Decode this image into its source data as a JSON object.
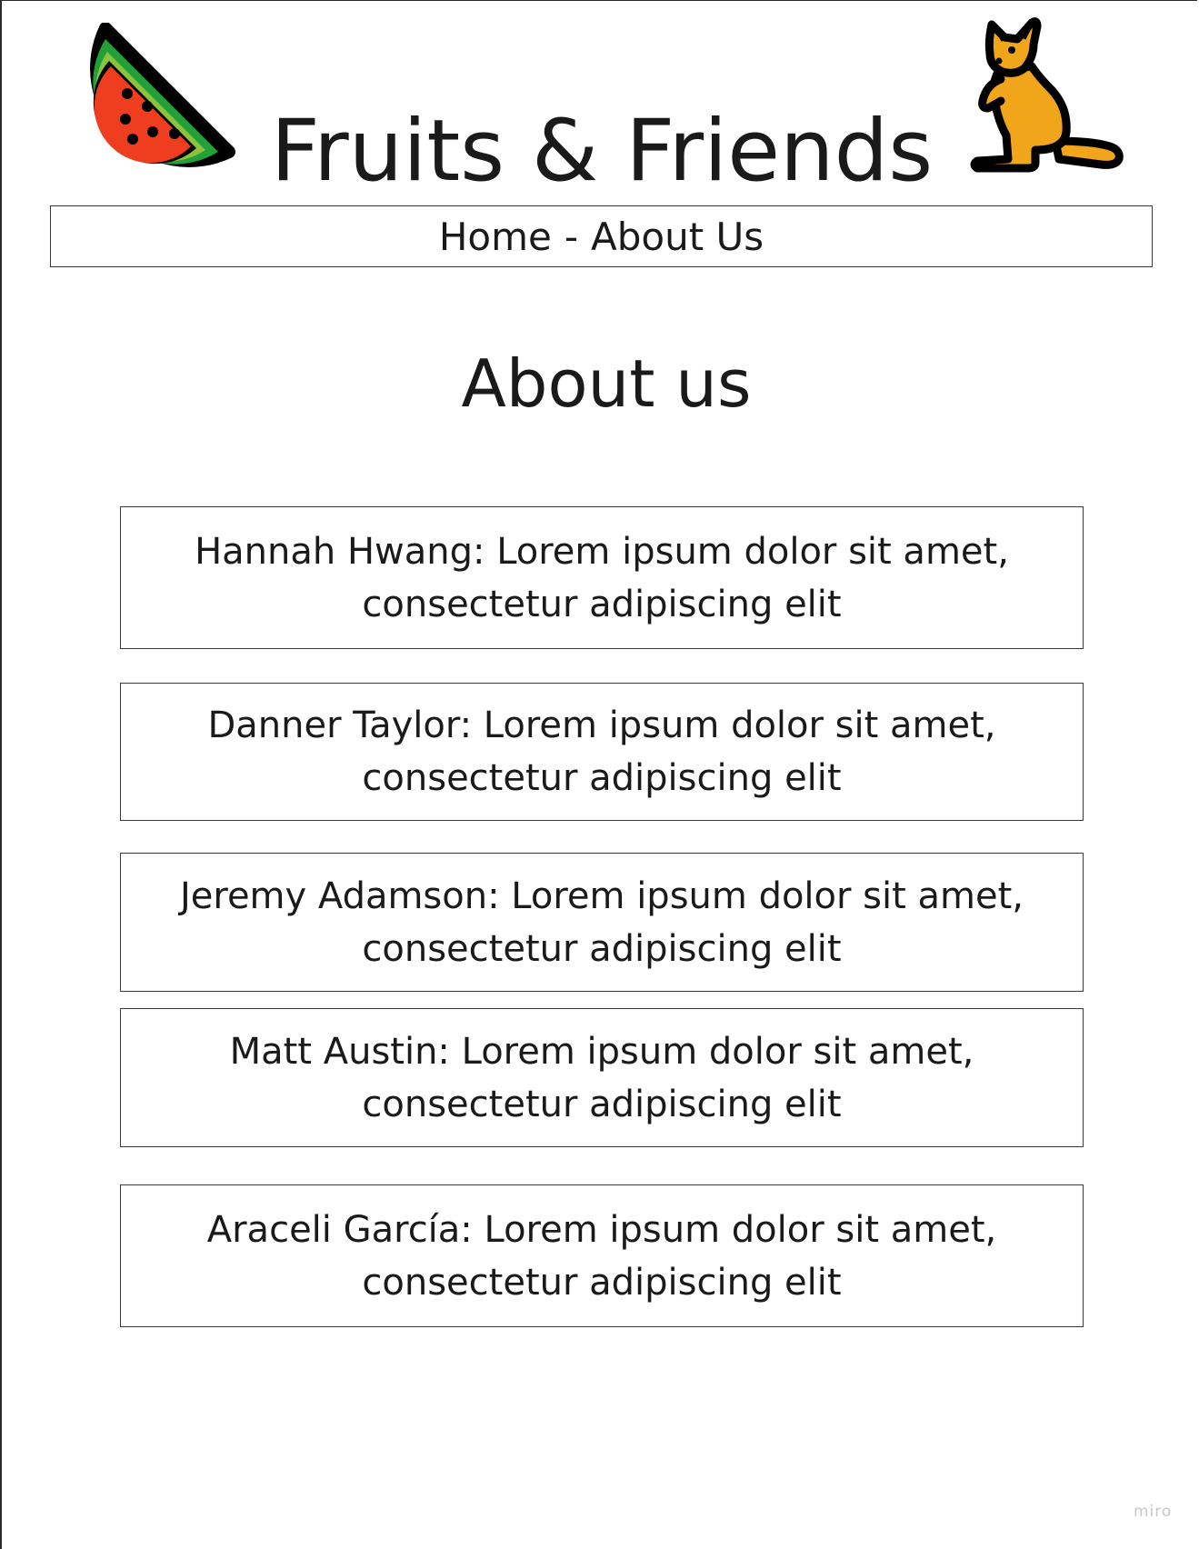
{
  "header": {
    "title": "Fruits & Friends",
    "left_logo_icon": "watermelon-icon",
    "right_logo_icon": "kangaroo-icon"
  },
  "nav": {
    "home_label": "Home",
    "separator": "-",
    "about_label": "About Us"
  },
  "main": {
    "heading": "About us",
    "members": [
      {
        "name": "Hannah Hwang",
        "line1": "Hannah Hwang: Lorem ipsum dolor sit amet,",
        "line2": "consectetur adipiscing elit"
      },
      {
        "name": "Danner Taylor",
        "line1": "Danner Taylor: Lorem ipsum dolor sit amet,",
        "line2": "consectetur adipiscing elit"
      },
      {
        "name": "Jeremy Adamson",
        "line1": "Jeremy Adamson: Lorem ipsum dolor sit amet,",
        "line2": "consectetur adipiscing elit"
      },
      {
        "name": "Matt Austin",
        "line1": "Matt Austin: Lorem ipsum dolor sit amet,",
        "line2": "consectetur adipiscing elit"
      },
      {
        "name": "Araceli García",
        "line1": "Araceli García: Lorem ipsum dolor sit amet,",
        "line2": "consectetur adipiscing elit"
      }
    ]
  },
  "watermark": "miro",
  "colors": {
    "watermelon_flesh": "#ef3e1f",
    "watermelon_rind_light": "#8bc23f",
    "watermelon_rind_dark": "#23a038",
    "kangaroo_body": "#f0a51b",
    "outline": "#000000",
    "border": "#3a3a3a"
  }
}
